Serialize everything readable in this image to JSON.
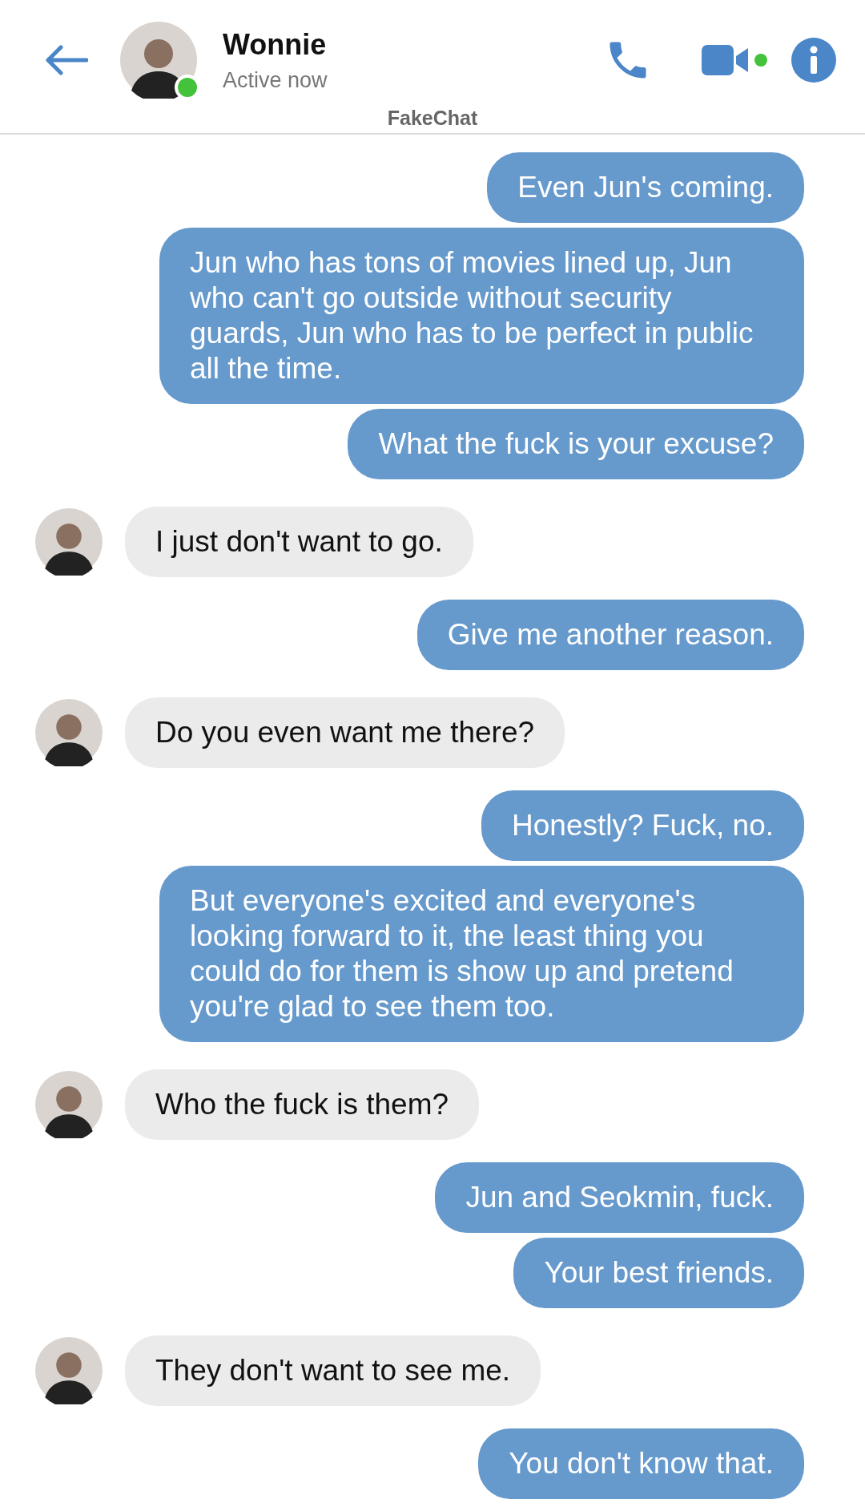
{
  "header": {
    "name": "Wonnie",
    "status": "Active now",
    "online": true,
    "app_label": "FakeChat",
    "video_dot": true
  },
  "messages": [
    {
      "kind": "me",
      "text": "Even Jun's coming."
    },
    {
      "kind": "me",
      "text": "Jun who has tons of movies lined up, Jun who can't go outside without security guards, Jun who has to be perfect in public all the time."
    },
    {
      "kind": "me",
      "text": "What the fuck is your excuse?"
    },
    {
      "kind": "them",
      "text": "I just don't want to go."
    },
    {
      "kind": "me",
      "text": "Give me another reason."
    },
    {
      "kind": "them",
      "text": "Do you even want me there?"
    },
    {
      "kind": "me",
      "text": "Honestly? Fuck, no."
    },
    {
      "kind": "me",
      "text": "But everyone's excited and everyone's looking forward to it, the least thing you could do for them is show up and pretend you're glad to see them too."
    },
    {
      "kind": "them",
      "text": "Who the fuck is them?"
    },
    {
      "kind": "me",
      "text": "Jun and Seokmin, fuck."
    },
    {
      "kind": "me",
      "text": "Your best friends."
    },
    {
      "kind": "them",
      "text": "They don't want to see me."
    },
    {
      "kind": "me",
      "text": "You don't know that."
    }
  ]
}
